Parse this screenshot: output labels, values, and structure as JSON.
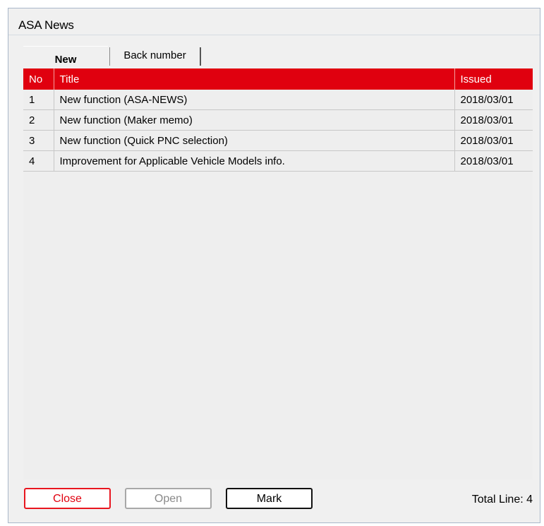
{
  "window": {
    "title": "ASA News"
  },
  "tabs": [
    {
      "label": "New",
      "active": true
    },
    {
      "label": "Back number",
      "active": false
    }
  ],
  "table": {
    "headers": {
      "no": "No",
      "title": "Title",
      "issued": "Issued"
    },
    "rows": [
      {
        "no": "1",
        "title": "New function (ASA-NEWS)",
        "issued": "2018/03/01"
      },
      {
        "no": "2",
        "title": "New function (Maker memo)",
        "issued": "2018/03/01"
      },
      {
        "no": "3",
        "title": "New function (Quick PNC selection)",
        "issued": "2018/03/01"
      },
      {
        "no": "4",
        "title": "Improvement for Applicable Vehicle Models info.",
        "issued": "2018/03/01"
      }
    ]
  },
  "footer": {
    "close_label": "Close",
    "open_label": "Open",
    "mark_label": "Mark",
    "total_line": "Total Line: 4"
  },
  "colors": {
    "header_red": "#e0000f",
    "close_border": "#e8161f",
    "window_bg": "#f0f0f0"
  }
}
